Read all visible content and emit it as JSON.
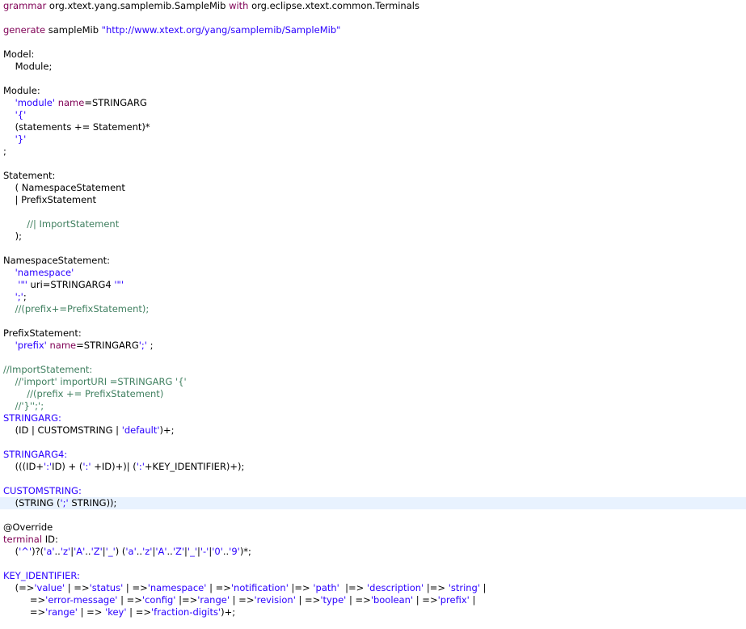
{
  "editor": {
    "language": "Xtext grammar",
    "colors": {
      "keyword": "#7f0055",
      "string": "#2a00ff",
      "comment": "#3f7f5f",
      "rule_name": "#2a00ff",
      "text": "#000000",
      "current_line": "#e8f2fe"
    },
    "current_line_index": 41,
    "lines": [
      [
        [
          "kw",
          "grammar"
        ],
        [
          "plain",
          " org.xtext.yang.samplemib.SampleMib "
        ],
        [
          "kw",
          "with"
        ],
        [
          "plain",
          " org.eclipse.xtext.common.Terminals"
        ]
      ],
      [],
      [
        [
          "kw",
          "generate"
        ],
        [
          "plain",
          " sampleMib "
        ],
        [
          "str",
          "\"http://www.xtext.org/yang/samplemib/SampleMib\""
        ]
      ],
      [],
      [
        [
          "plain",
          "Model:"
        ]
      ],
      [
        [
          "plain",
          "    Module;"
        ]
      ],
      [],
      [
        [
          "plain",
          "Module:"
        ]
      ],
      [
        [
          "plain",
          "    "
        ],
        [
          "str",
          "'module'"
        ],
        [
          "plain",
          " "
        ],
        [
          "kw",
          "name"
        ],
        [
          "plain",
          "=STRINGARG"
        ]
      ],
      [
        [
          "plain",
          "    "
        ],
        [
          "str",
          "'{'"
        ]
      ],
      [
        [
          "plain",
          "    (statements += Statement)*"
        ]
      ],
      [
        [
          "plain",
          "    "
        ],
        [
          "str",
          "'}'"
        ]
      ],
      [
        [
          "plain",
          ";"
        ]
      ],
      [],
      [
        [
          "plain",
          "Statement:"
        ]
      ],
      [
        [
          "plain",
          "    ( NamespaceStatement"
        ]
      ],
      [
        [
          "plain",
          "    | PrefixStatement"
        ]
      ],
      [],
      [
        [
          "plain",
          "        "
        ],
        [
          "com",
          "//| ImportStatement"
        ]
      ],
      [
        [
          "plain",
          "    );"
        ]
      ],
      [],
      [
        [
          "plain",
          "NamespaceStatement:"
        ]
      ],
      [
        [
          "plain",
          "    "
        ],
        [
          "str",
          "'namespace'"
        ]
      ],
      [
        [
          "plain",
          "     "
        ],
        [
          "str",
          "'\"'"
        ],
        [
          "plain",
          " uri=STRINGARG4 "
        ],
        [
          "str",
          "'\"'"
        ]
      ],
      [
        [
          "plain",
          "    "
        ],
        [
          "str",
          "';'"
        ],
        [
          "plain",
          ";"
        ]
      ],
      [
        [
          "plain",
          "    "
        ],
        [
          "com",
          "//(prefix+=PrefixStatement);"
        ]
      ],
      [],
      [
        [
          "plain",
          "PrefixStatement:"
        ]
      ],
      [
        [
          "plain",
          "    "
        ],
        [
          "str",
          "'prefix'"
        ],
        [
          "plain",
          " "
        ],
        [
          "kw",
          "name"
        ],
        [
          "plain",
          "=STRINGARG"
        ],
        [
          "str",
          "';'"
        ],
        [
          "plain",
          " ;"
        ]
      ],
      [],
      [
        [
          "com",
          "//ImportStatement:"
        ]
      ],
      [
        [
          "plain",
          "    "
        ],
        [
          "com",
          "//'import' importURI =STRINGARG '{'"
        ]
      ],
      [
        [
          "plain",
          "        "
        ],
        [
          "com",
          "//(prefix += PrefixStatement)"
        ]
      ],
      [
        [
          "plain",
          "    "
        ],
        [
          "com",
          "//'}'';';"
        ]
      ],
      [
        [
          "blue",
          "STRINGARG:"
        ]
      ],
      [
        [
          "plain",
          "    (ID | CUSTOMSTRING | "
        ],
        [
          "str",
          "'default'"
        ],
        [
          "plain",
          ")+;"
        ]
      ],
      [],
      [
        [
          "blue",
          "STRINGARG4:"
        ]
      ],
      [
        [
          "plain",
          "    (((ID+"
        ],
        [
          "str",
          "':'"
        ],
        [
          "plain",
          "ID) + ("
        ],
        [
          "str",
          "':'"
        ],
        [
          "plain",
          " +ID)+)| ("
        ],
        [
          "str",
          "':'"
        ],
        [
          "plain",
          "+KEY_IDENTIFIER)+);"
        ]
      ],
      [],
      [
        [
          "blue",
          "CUSTOMSTRING:"
        ]
      ],
      [
        [
          "plain",
          "    (STRING ("
        ],
        [
          "str",
          "';'"
        ],
        [
          "plain",
          " STRING));"
        ]
      ],
      [],
      [
        [
          "plain",
          "@Override"
        ]
      ],
      [
        [
          "kw",
          "terminal"
        ],
        [
          "plain",
          " ID:"
        ]
      ],
      [
        [
          "plain",
          "    ("
        ],
        [
          "str",
          "'^'"
        ],
        [
          "plain",
          ")?("
        ],
        [
          "str",
          "'a'"
        ],
        [
          "plain",
          ".."
        ],
        [
          "str",
          "'z'"
        ],
        [
          "plain",
          "|"
        ],
        [
          "str",
          "'A'"
        ],
        [
          "plain",
          ".."
        ],
        [
          "str",
          "'Z'"
        ],
        [
          "plain",
          "|"
        ],
        [
          "str",
          "'_'"
        ],
        [
          "plain",
          ") ("
        ],
        [
          "str",
          "'a'"
        ],
        [
          "plain",
          ".."
        ],
        [
          "str",
          "'z'"
        ],
        [
          "plain",
          "|"
        ],
        [
          "str",
          "'A'"
        ],
        [
          "plain",
          ".."
        ],
        [
          "str",
          "'Z'"
        ],
        [
          "plain",
          "|"
        ],
        [
          "str",
          "'_'"
        ],
        [
          "plain",
          "|"
        ],
        [
          "str",
          "'-'"
        ],
        [
          "plain",
          "|"
        ],
        [
          "str",
          "'0'"
        ],
        [
          "plain",
          ".."
        ],
        [
          "str",
          "'9'"
        ],
        [
          "plain",
          ")*;"
        ]
      ],
      [],
      [
        [
          "blue",
          "KEY_IDENTIFIER:"
        ]
      ],
      [
        [
          "plain",
          "    (=>"
        ],
        [
          "str",
          "'value'"
        ],
        [
          "plain",
          " | =>"
        ],
        [
          "str",
          "'status'"
        ],
        [
          "plain",
          " | =>"
        ],
        [
          "str",
          "'namespace'"
        ],
        [
          "plain",
          " | =>"
        ],
        [
          "str",
          "'notification'"
        ],
        [
          "plain",
          " |=> "
        ],
        [
          "str",
          "'path'"
        ],
        [
          "plain",
          "  |=> "
        ],
        [
          "str",
          "'description'"
        ],
        [
          "plain",
          " |=> "
        ],
        [
          "str",
          "'string'"
        ],
        [
          "plain",
          " |"
        ]
      ],
      [
        [
          "plain",
          "         =>"
        ],
        [
          "str",
          "'error-message'"
        ],
        [
          "plain",
          " | =>"
        ],
        [
          "str",
          "'config'"
        ],
        [
          "plain",
          " |=>"
        ],
        [
          "str",
          "'range'"
        ],
        [
          "plain",
          " | =>"
        ],
        [
          "str",
          "'revision'"
        ],
        [
          "plain",
          " | =>"
        ],
        [
          "str",
          "'type'"
        ],
        [
          "plain",
          " | =>"
        ],
        [
          "str",
          "'boolean'"
        ],
        [
          "plain",
          " | =>"
        ],
        [
          "str",
          "'prefix'"
        ],
        [
          "plain",
          " |"
        ]
      ],
      [
        [
          "plain",
          "         =>"
        ],
        [
          "str",
          "'range'"
        ],
        [
          "plain",
          " | => "
        ],
        [
          "str",
          "'key'"
        ],
        [
          "plain",
          " | =>"
        ],
        [
          "str",
          "'fraction-digits'"
        ],
        [
          "plain",
          ")+;"
        ]
      ]
    ]
  }
}
